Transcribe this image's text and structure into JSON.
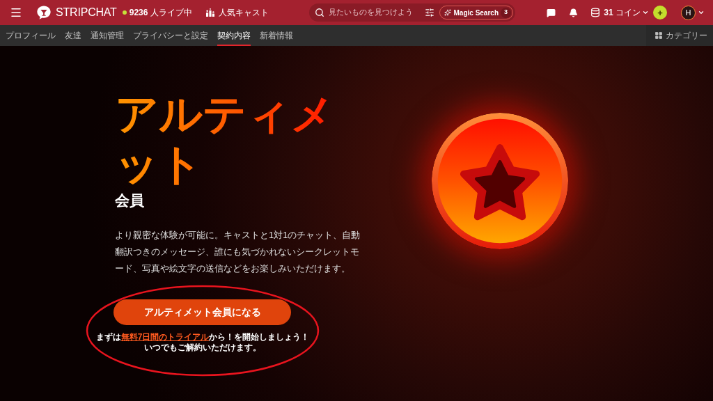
{
  "top_bar": {
    "logo": "**STRIP**CHAT",
    "live_count": "**9236** 人ライブ中",
    "popular_link": "人気キャスト",
    "search": {
      "placeholder": "見たいものを見つけよう"
    },
    "magic_search": {
      "label": "Magic Search",
      "count": "3"
    },
    "coins": "**31** コイン",
    "add_button": "+",
    "avatar": "H"
  },
  "nav_tabs": [
    {
      "label": "プロフィール",
      "selected": false
    },
    {
      "label": "友達",
      "selected": false
    },
    {
      "label": "通知管理",
      "selected": false
    },
    {
      "label": "プライバシーと設定",
      "selected": false
    },
    {
      "label": "契約内容",
      "selected": true
    },
    {
      "label": "新着情報",
      "selected": false
    }
  ],
  "category_button": "カテゴリー",
  "hero": {
    "title": "アルティメット",
    "subtitle": "会員",
    "description": "より親密な体験が可能に。キャストと1対1のチャット、自動翻訳つきのメッセージ、誰にも気づかれないシークレットモード、写真や絵文字の送信などをお楽しみいただけます。",
    "cta_button": "アルティメット会員になる",
    "trial_note": {
      "text_before": "まずは",
      "link": "無料7日間のトライアル",
      "text_after": "から！を開始しましょう！",
      "second_line": "いつでもご解約いただけます。"
    }
  }
}
